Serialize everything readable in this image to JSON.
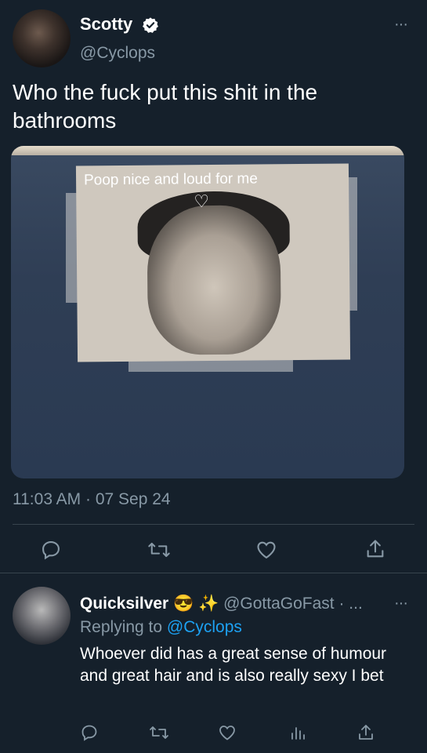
{
  "tweet": {
    "author": {
      "name": "Scotty",
      "handle": "@Cyclops",
      "verified": true
    },
    "text": "Who the fuck put this shit in the bathrooms",
    "media": {
      "caption_in_image": "Poop nice and loud for me",
      "heart_glyph": "♡"
    },
    "timestamp": "11:03 AM · 07 Sep 24",
    "more_glyph": "···",
    "actions": [
      "reply-icon",
      "retweet-icon",
      "like-icon",
      "share-icon"
    ]
  },
  "reply": {
    "name": "Quicksilver",
    "emoji": "😎 ✨",
    "handle": "@GottaGoFast",
    "meta_suffix": " · ...",
    "replying_prefix": "Replying to ",
    "replying_to": "@Cyclops",
    "text": "Whoever did has a great sense of humour and great hair and is also really sexy I bet",
    "more_glyph": "···",
    "actions": [
      "reply-icon",
      "retweet-icon",
      "like-icon",
      "analytics-icon",
      "share-icon"
    ]
  },
  "colors": {
    "background": "#15202b",
    "secondary_text": "#8899a6",
    "link": "#1da1f2",
    "divider": "#38444d"
  }
}
